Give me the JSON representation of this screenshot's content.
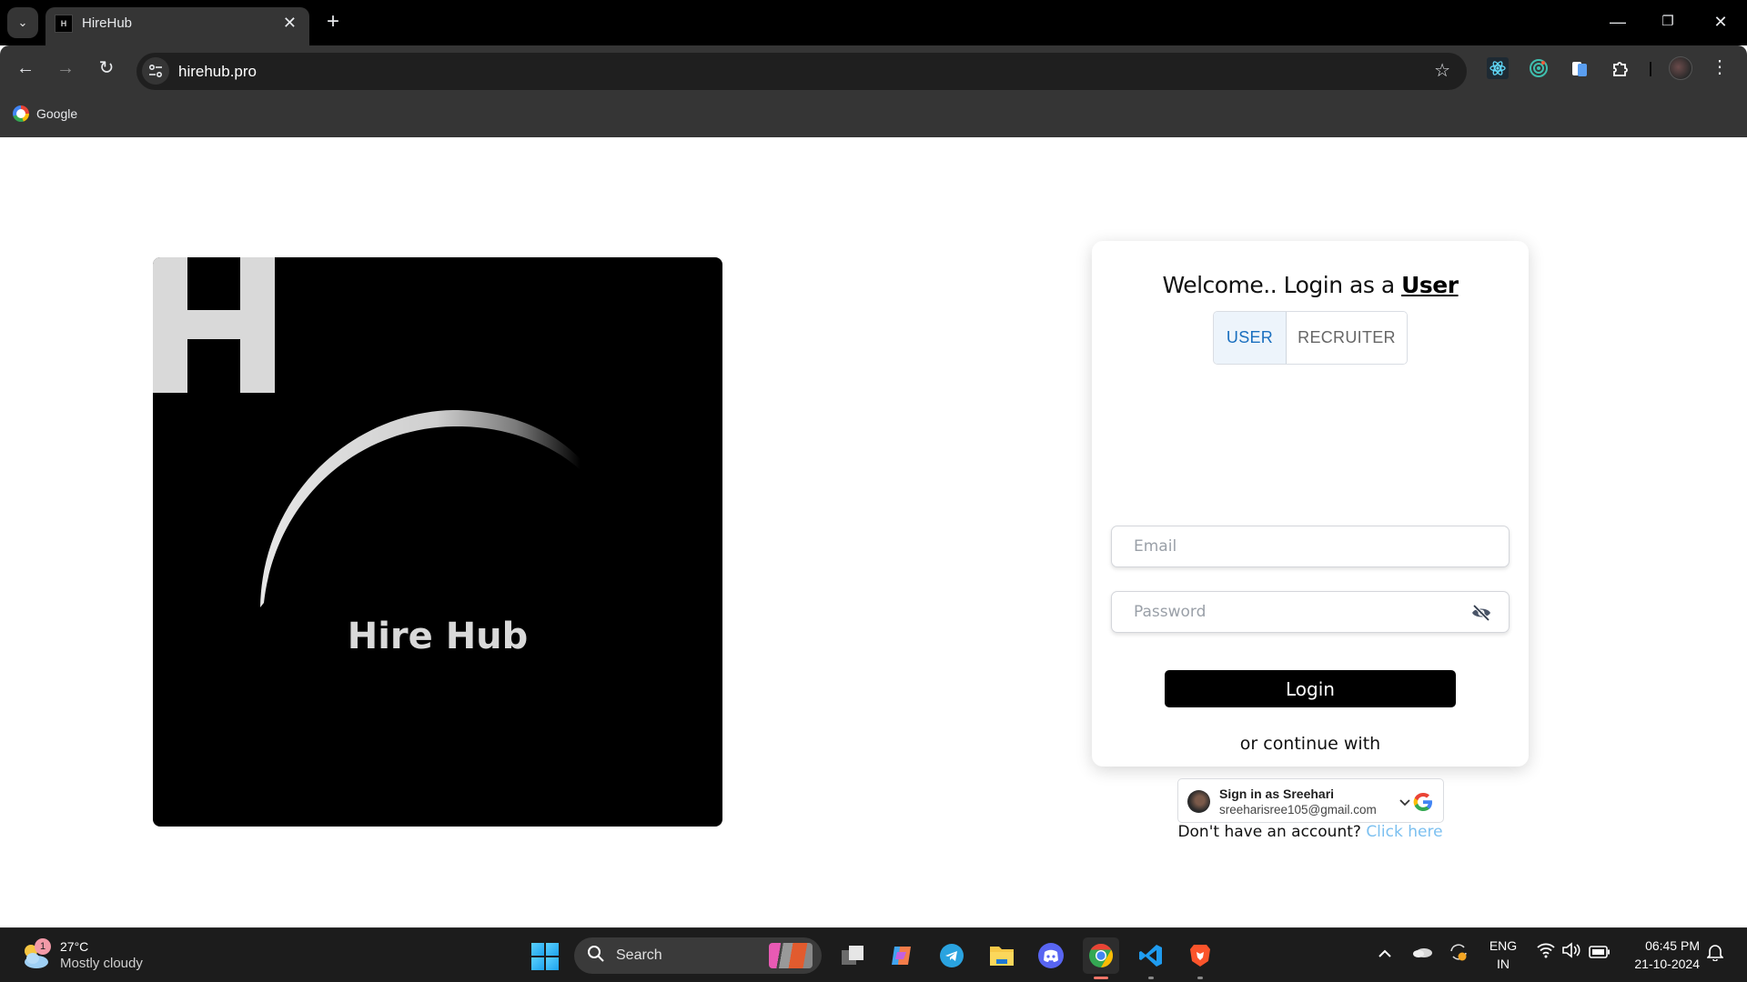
{
  "browser": {
    "tab": {
      "title": "HireHub",
      "favicon": "H"
    },
    "new_tab_symbol": "+",
    "url": "hirehub.pro",
    "bookmarks": [
      {
        "label": "Google"
      }
    ],
    "window_controls": {
      "minimize": "—",
      "restore": "❐",
      "close": "✕"
    },
    "icons": {
      "tab_search": "⌄",
      "tab_close": "✕",
      "back": "←",
      "forward": "→",
      "reload": "↻",
      "site_info": "⚙",
      "star": "☆",
      "menu": "⋮"
    },
    "extensions": [
      "react-devtools-icon",
      "extension-target-icon",
      "extension-files-icon",
      "extensions-puzzle-icon"
    ]
  },
  "logo": {
    "letter": "H",
    "text": "Hire Hub"
  },
  "login": {
    "welcome_prefix": "Welcome.. Login as a ",
    "welcome_role": "User",
    "roles": [
      {
        "label": "USER",
        "selected": true
      },
      {
        "label": "RECRUITER",
        "selected": false
      }
    ],
    "email": {
      "value": "",
      "placeholder": "Email"
    },
    "password": {
      "value": "",
      "placeholder": "Password"
    },
    "login_button": "Login",
    "or_continue": "or continue with",
    "google": {
      "title": "Sign in as Sreehari",
      "email": "sreeharisree105@gmail.com"
    },
    "signup_prompt": "Don't have an account? ",
    "signup_link": "Click here",
    "colors": {
      "role_active": "#1a6fbf",
      "link": "#7cc0f0",
      "button_bg": "#000000"
    }
  },
  "taskbar": {
    "weather": {
      "badge": "1",
      "temp": "27°C",
      "desc": "Mostly cloudy"
    },
    "search_label": "Search",
    "apps": [
      "task-view",
      "copilot",
      "telegram",
      "file-explorer",
      "discord",
      "chrome",
      "vscode",
      "brave"
    ],
    "tray": {
      "lang_top": "ENG",
      "lang_bottom": "IN",
      "time": "06:45 PM",
      "date": "21-10-2024"
    }
  }
}
